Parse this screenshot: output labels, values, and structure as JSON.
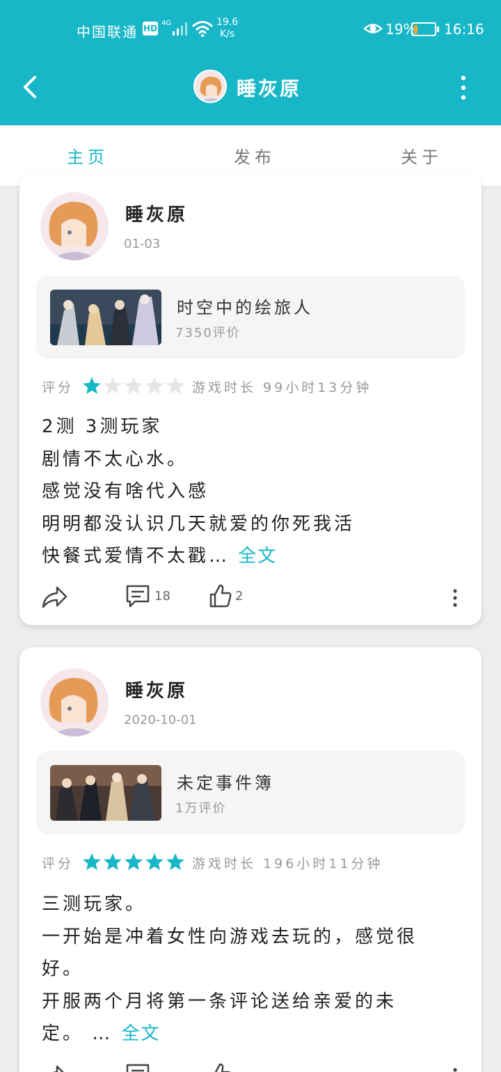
{
  "status_bar": {
    "carrier": "中国联通",
    "hd": "HD",
    "network": "4G",
    "speed_value": "19.6",
    "speed_unit": "K/s",
    "battery_percent": "19%",
    "battery_level": 0.19,
    "time": "16:16"
  },
  "header": {
    "title": "睡灰原",
    "icons": [
      "back-arrow-icon",
      "avatar",
      "more-vertical-icon"
    ]
  },
  "tabs": [
    {
      "label": "主页",
      "active": true
    },
    {
      "label": "发布",
      "active": false
    },
    {
      "label": "关于",
      "active": false
    }
  ],
  "reviews": [
    {
      "user": "睡灰原",
      "date": "01-03",
      "game": {
        "name": "时空中的绘旅人",
        "reviews": "7350评价"
      },
      "rating_label": "评分",
      "stars": 1,
      "stars_max": 5,
      "playtime": "游戏时长 99小时13分钟",
      "lines": [
        "2测 3测玩家",
        "剧情不太心水。",
        "感觉没有啥代入感",
        "明明都没认识几天就爱的你死我活",
        "快餐式爱情不太戳"
      ],
      "ellipsis": "…",
      "more": "全文",
      "comments": "18",
      "likes": "2"
    },
    {
      "user": "睡灰原",
      "date": "2020-10-01",
      "game": {
        "name": "未定事件簿",
        "reviews": "1万评价"
      },
      "rating_label": "评分",
      "stars": 5,
      "stars_max": 5,
      "playtime": "游戏时长 196小时11分钟",
      "lines": [
        "三测玩家。",
        "一开始是冲着女性向游戏去玩的，感觉很",
        "好。",
        "开服两个月将第一条评论送给亲爱的未",
        "定。"
      ],
      "ellipsis": "…",
      "more": "全文",
      "comments": "",
      "likes": ""
    }
  ],
  "colors": {
    "accent": "#17b7c7",
    "star_off": "#e6e6e6",
    "battery": "#f7a823"
  }
}
